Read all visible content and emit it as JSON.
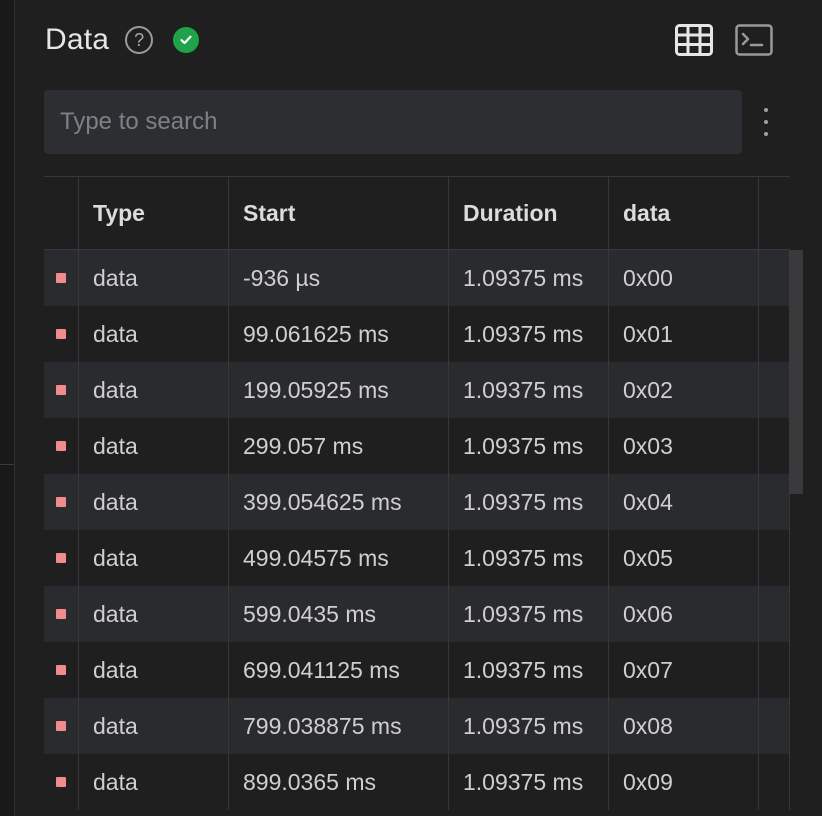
{
  "panel": {
    "title": "Data",
    "help_glyph": "?",
    "status_icon": "check-circle-icon",
    "status_color": "#1fa34a",
    "tools": [
      "table-icon",
      "terminal-icon"
    ]
  },
  "search": {
    "placeholder": "Type to search",
    "value": ""
  },
  "table": {
    "columns": [
      "Type",
      "Start",
      "Duration",
      "data"
    ],
    "marker_color": "#f28b8b",
    "rows": [
      {
        "type": "data",
        "start": "-936 µs",
        "duration": "1.09375 ms",
        "data": "0x00"
      },
      {
        "type": "data",
        "start": "99.061625 ms",
        "duration": "1.09375 ms",
        "data": "0x01"
      },
      {
        "type": "data",
        "start": "199.05925 ms",
        "duration": "1.09375 ms",
        "data": "0x02"
      },
      {
        "type": "data",
        "start": "299.057 ms",
        "duration": "1.09375 ms",
        "data": "0x03"
      },
      {
        "type": "data",
        "start": "399.054625 ms",
        "duration": "1.09375 ms",
        "data": "0x04"
      },
      {
        "type": "data",
        "start": "499.04575 ms",
        "duration": "1.09375 ms",
        "data": "0x05"
      },
      {
        "type": "data",
        "start": "599.0435 ms",
        "duration": "1.09375 ms",
        "data": "0x06"
      },
      {
        "type": "data",
        "start": "699.041125 ms",
        "duration": "1.09375 ms",
        "data": "0x07"
      },
      {
        "type": "data",
        "start": "799.038875 ms",
        "duration": "1.09375 ms",
        "data": "0x08"
      },
      {
        "type": "data",
        "start": "899.0365 ms",
        "duration": "1.09375 ms",
        "data": "0x09"
      }
    ]
  }
}
